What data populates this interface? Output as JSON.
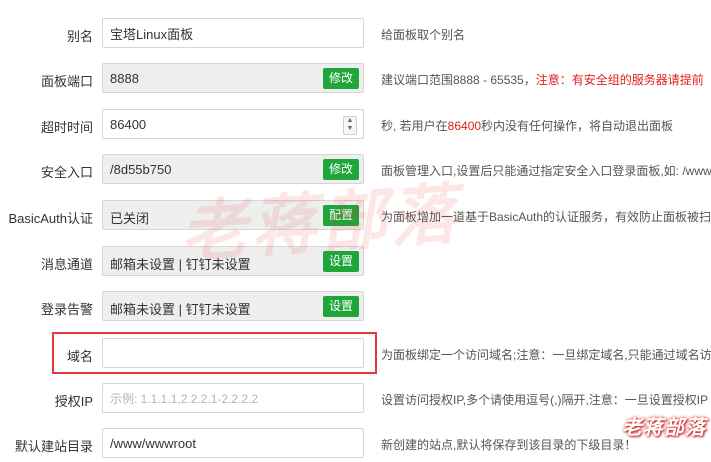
{
  "settings": [
    {
      "label": "别名",
      "value": "宝塔Linux面板",
      "description": "给面板取个别名"
    },
    {
      "label": "面板端口",
      "value": "8888",
      "button": "修改",
      "description_prefix": "建议端口范围8888 - 65535，",
      "description_warning": "注意：有安全组的服务器请提前"
    },
    {
      "label": "超时时间",
      "value": "86400",
      "description_prefix": "秒, 若用户在",
      "description_highlight": "86400",
      "description_suffix": "秒内没有任何操作，将自动退出面板"
    },
    {
      "label": "安全入口",
      "value": "/8d55b750",
      "button": "修改",
      "description": "面板管理入口,设置后只能通过指定安全入口登录面板,如: /www"
    },
    {
      "label": "BasicAuth认证",
      "value": "已关闭",
      "button": "配置",
      "description": "为面板增加一道基于BasicAuth的认证服务，有效防止面板被扫"
    },
    {
      "label": "消息通道",
      "value": "邮箱未设置 | 钉钉未设置",
      "button": "设置",
      "description": ""
    },
    {
      "label": "登录告警",
      "value": "邮箱未设置 | 钉钉未设置",
      "button": "设置",
      "description": ""
    },
    {
      "label": "域名",
      "value": "",
      "description": "为面板绑定一个访问域名;注意：一旦绑定域名,只能通过域名访"
    },
    {
      "label": "授权IP",
      "value": "",
      "placeholder": "示例: 1.1.1.1,2.2.2.1-2.2.2.2",
      "description": "设置访问授权IP,多个请使用逗号(,)隔开,注意：一旦设置授权IP"
    },
    {
      "label": "默认建站目录",
      "value": "/www/wwwroot",
      "description": "新创建的站点,默认将保存到该目录的下级目录！"
    }
  ],
  "watermark": {
    "text": "老蒋部落"
  },
  "colors": {
    "accent": "#20a53a",
    "warning": "#e02020",
    "highlight_border": "#e53935"
  }
}
